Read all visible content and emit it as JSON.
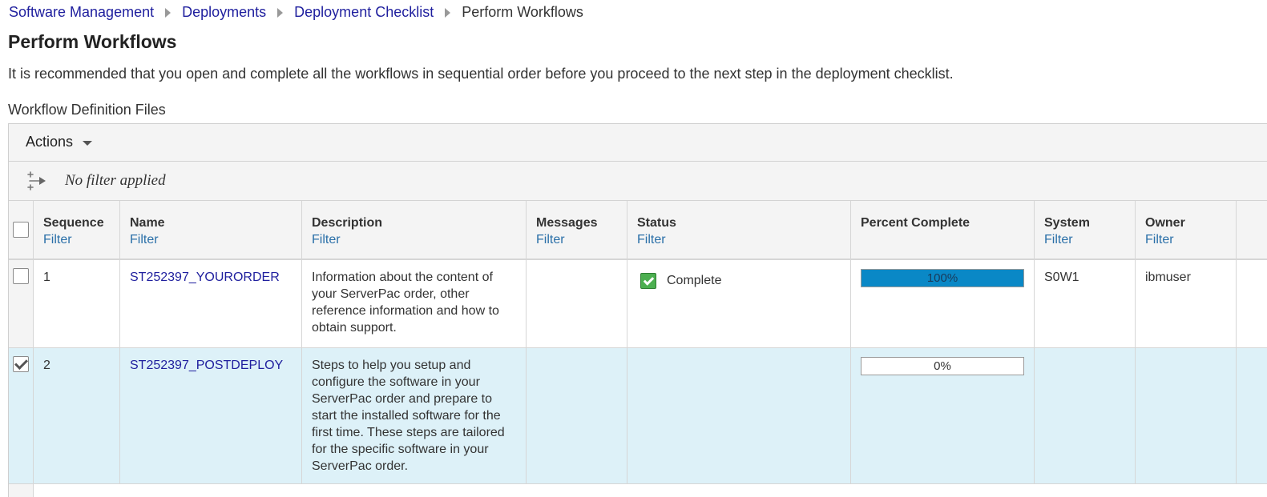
{
  "breadcrumb": {
    "items": [
      "Software Management",
      "Deployments",
      "Deployment Checklist"
    ],
    "current": "Perform Workflows"
  },
  "page": {
    "title": "Perform Workflows",
    "description": "It is recommended that you open and complete all the workflows in sequential order before you proceed to the next step in the deployment checklist.",
    "section_label": "Workflow Definition Files"
  },
  "toolbar": {
    "actions_label": "Actions"
  },
  "filterbar": {
    "text": "No filter applied"
  },
  "columns": [
    {
      "title": "Sequence",
      "filter": "Filter"
    },
    {
      "title": "Name",
      "filter": "Filter"
    },
    {
      "title": "Description",
      "filter": "Filter"
    },
    {
      "title": "Messages",
      "filter": "Filter"
    },
    {
      "title": "Status",
      "filter": "Filter"
    },
    {
      "title": "Percent Complete",
      "filter": ""
    },
    {
      "title": "System",
      "filter": "Filter"
    },
    {
      "title": "Owner",
      "filter": "Filter"
    }
  ],
  "rows": [
    {
      "selected": false,
      "sequence": "1",
      "name": "ST252397_YOURORDER",
      "description": "Information about the content of your ServerPac order, other reference information and how to obtain support.",
      "messages": "",
      "status": "Complete",
      "status_icon": "complete-check-icon",
      "percent": 100,
      "percent_label": "100%",
      "system": "S0W1",
      "owner": "ibmuser"
    },
    {
      "selected": true,
      "sequence": "2",
      "name": "ST252397_POSTDEPLOY",
      "description": "Steps to help you setup and configure the software in your ServerPac order and prepare to start the installed software for the first time. These steps are tailored for the specific software in your ServerPac order.",
      "messages": "",
      "status": "",
      "percent": 0,
      "percent_label": "0%",
      "system": "",
      "owner": ""
    }
  ],
  "colors": {
    "link": "#1f1f9e",
    "filter_link": "#2a6fa8",
    "progress_fill": "#0a88c6",
    "selected_row": "#ddf1f8",
    "status_complete": "#4caf50"
  }
}
